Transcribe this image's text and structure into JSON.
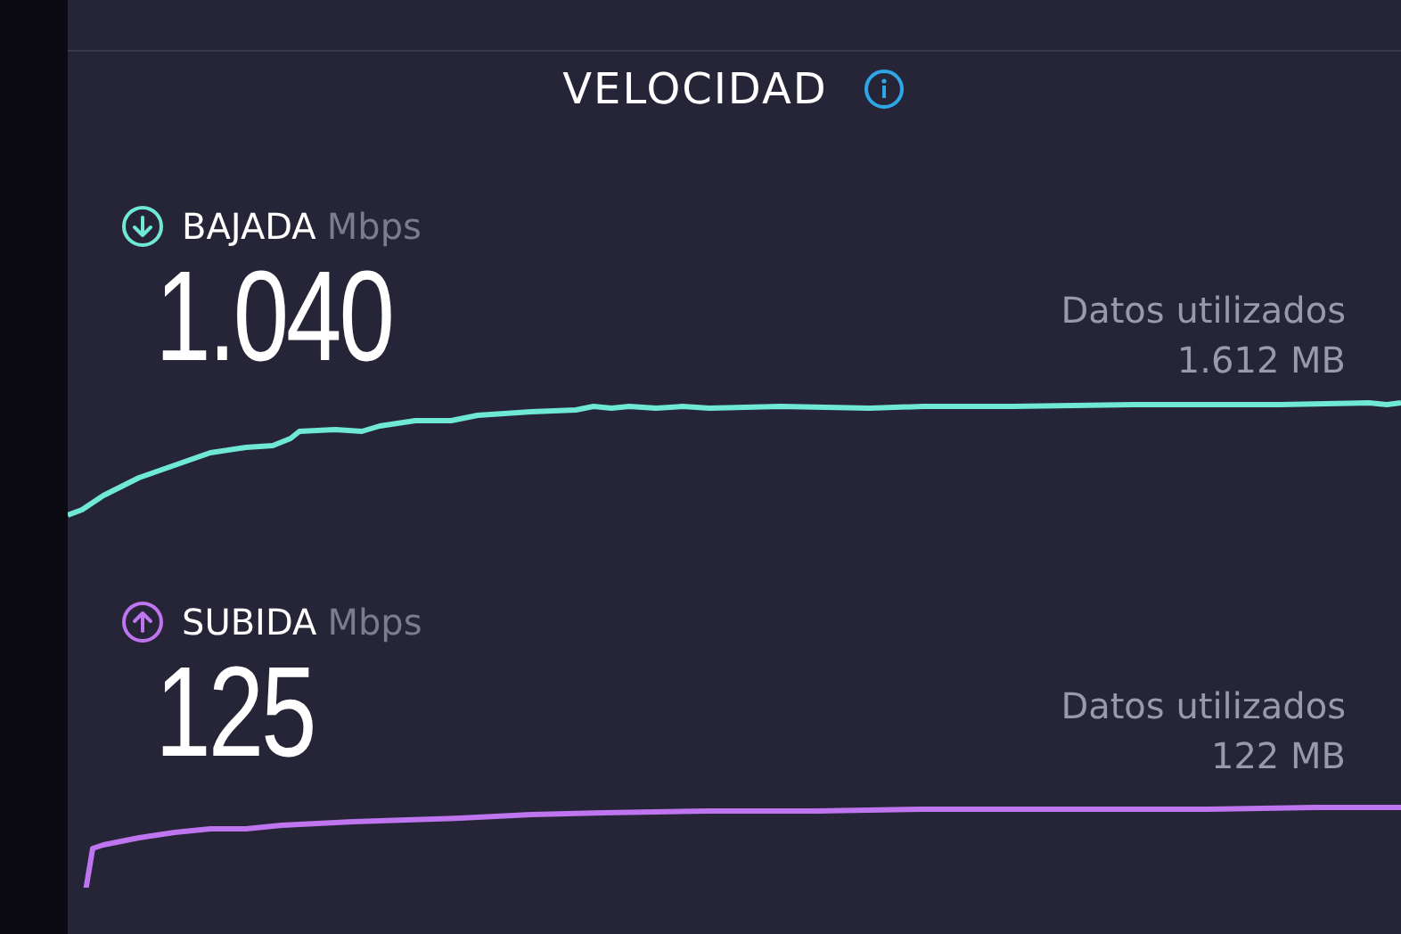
{
  "title": "VELOCIDAD",
  "metrics": [
    {
      "kind": "download",
      "label": "BAJADA",
      "unit": "Mbps",
      "value": "1.040",
      "data_label": "Datos utilizados",
      "data_value": "1.612 MB",
      "color": "#6fe9d6"
    },
    {
      "kind": "upload",
      "label": "SUBIDA",
      "unit": "Mbps",
      "value": "125",
      "data_label": "Datos utilizados",
      "data_value": "122 MB",
      "color": "#bf74f0"
    }
  ]
}
